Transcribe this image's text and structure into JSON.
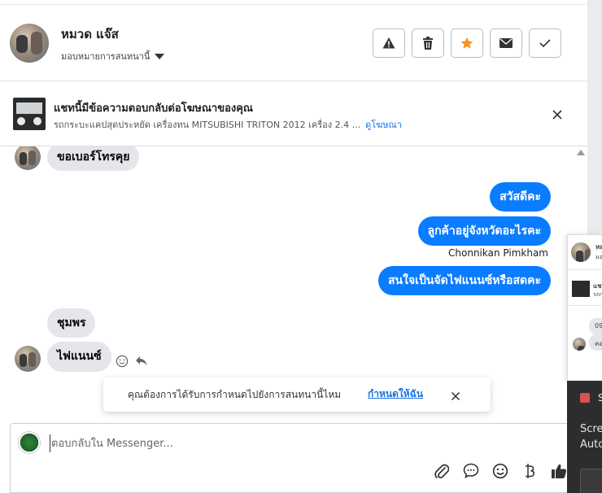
{
  "header": {
    "contact_name": "หมวด แจ๊ส",
    "assign_label": "มอบหมายการสนทนานี้",
    "actions": [
      {
        "label": "spam",
        "icon": "warning-icon"
      },
      {
        "label": "delete",
        "icon": "trash-icon"
      },
      {
        "label": "star",
        "icon": "star-icon",
        "color": "#f7931e"
      },
      {
        "label": "mark-unread",
        "icon": "envelope-icon"
      },
      {
        "label": "mark-done",
        "icon": "check-icon"
      }
    ]
  },
  "ad_banner": {
    "title": "แชทนี้มีข้อความตอบกลับต่อโฆษณาของคุณ",
    "description": "รถกระบะแคปสุดประหยัด เครื่องทน MITSUBISHI TRITON 2012 เครื่อง 2.4 ...",
    "link": "ดูโฆษณา"
  },
  "messages": {
    "incoming_top": "ขอเบอร์โทรคุย",
    "outgoing": [
      "สวัสดีคะ",
      "ลูกค้าอยู่จังหวัดอะไรคะ",
      "สนใจเป็นจัดไฟแนนซ์หรือสดคะ"
    ],
    "sender_name": "Chonnikan Pimkham",
    "incoming_bottom": [
      "ชุมพร",
      "ไฟแนนซ์"
    ]
  },
  "assign_prompt": {
    "text": "คุณต้องการได้รับการกำหนดไปยังการสนทนานี้ไหม",
    "link": "กำหนดให้ฉัน"
  },
  "composer": {
    "placeholder": "ตอบกลับใน Messenger..."
  },
  "side_panel": {
    "snippets": [
      "หม",
      "มอ",
      "แช",
      "รถก",
      "09",
      "คอ"
    ],
    "dark_texts": [
      "S",
      "Scre",
      "Auto"
    ]
  },
  "colors": {
    "accent": "#0a7cff",
    "link": "#1b74e4",
    "incoming_bubble": "#e4e6eb"
  }
}
